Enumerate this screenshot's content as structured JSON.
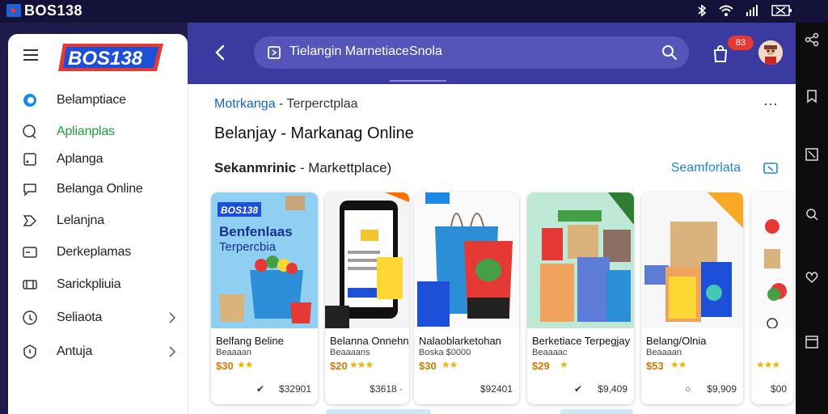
{
  "status_bar": {
    "app_title": "BOS138",
    "icons": [
      "app-logo-icon",
      "bluetooth-icon",
      "wifi-icon",
      "signal-icon",
      "battery-icon"
    ]
  },
  "header": {
    "search_value": "Tielangin MarnetiaceSnola",
    "cart_badge": "83",
    "icons": [
      "back-icon",
      "document-icon",
      "search-icon",
      "cart-icon",
      "avatar"
    ]
  },
  "drawer": {
    "logo_text": "BOS138",
    "items": [
      {
        "label": "Belamptiace",
        "icon": "toggle-icon",
        "active": false,
        "chevron": false
      },
      {
        "label": "Aplianplas",
        "icon": "chat-icon",
        "active": true,
        "chevron": false
      },
      {
        "label": "Aplanga",
        "icon": "square-icon",
        "active": false,
        "chevron": false
      },
      {
        "label": "Belanga Online",
        "icon": "message-icon",
        "active": false,
        "chevron": false
      },
      {
        "label": "Lelanjna",
        "icon": "tag-icon",
        "active": false,
        "chevron": false
      },
      {
        "label": "Derkeplamas",
        "icon": "card-icon",
        "active": false,
        "chevron": false
      },
      {
        "label": "Sarickpliuia",
        "icon": "cart-icon",
        "active": false,
        "chevron": false
      },
      {
        "label": "Seliaota",
        "icon": "info-icon",
        "active": false,
        "chevron": true
      },
      {
        "label": "Antuja",
        "icon": "shield-icon",
        "active": false,
        "chevron": true
      }
    ]
  },
  "content": {
    "breadcrumb_link": "Motrkanga",
    "breadcrumb_sep": " - ",
    "breadcrumb_current": "Terperctplaa",
    "more": "···",
    "page_title": "Belanjay - Markanag Online",
    "section_bold": "Sekanmrinic",
    "section_rest": " - Markettplace)",
    "see_all": "Seamforlata"
  },
  "products": [
    {
      "title": "Belfang Beline",
      "sub": "Beaaaan",
      "price": "$30",
      "stars": "★★",
      "action": "✔",
      "total": "$32901",
      "thumb_text_1": "Benfenlaas",
      "thumb_text_2": "Terpercbia",
      "badge": "BOS138"
    },
    {
      "title": "Belanna Onnehnpj",
      "sub": "Beaaaans",
      "price": "$20",
      "stars": "★★★",
      "action": "",
      "total": "$3618 ·",
      "thumb_text_1": "",
      "thumb_text_2": "",
      "badge": ""
    },
    {
      "title": "Nalaoblarketohan",
      "sub": "Boska $0000",
      "price": "$30",
      "stars": "★★",
      "action": "",
      "total": "$92401",
      "thumb_text_1": "",
      "thumb_text_2": "",
      "badge": ""
    },
    {
      "title": "Berketiace Terpegjay",
      "sub": "Beaaaac",
      "price": "$29",
      "stars": "★",
      "action": "✔",
      "total": "$9,409",
      "thumb_text_1": "",
      "thumb_text_2": "",
      "badge": ""
    },
    {
      "title": "Belang/Olnia",
      "sub": "Beaaaan",
      "price": "$53",
      "stars": "★★",
      "action": "○",
      "total": "$9,909",
      "thumb_text_1": "",
      "thumb_text_2": "",
      "badge": ""
    },
    {
      "title": "",
      "sub": "",
      "price": "",
      "stars": "★★★",
      "action": "",
      "total": "$00",
      "thumb_text_1": "",
      "thumb_text_2": "",
      "badge": ""
    }
  ],
  "colors": {
    "header_bg": "#3b3aa0",
    "accent_green": "#1f9d3d",
    "link_blue": "#1565c0",
    "price_orange": "#d07a00"
  }
}
